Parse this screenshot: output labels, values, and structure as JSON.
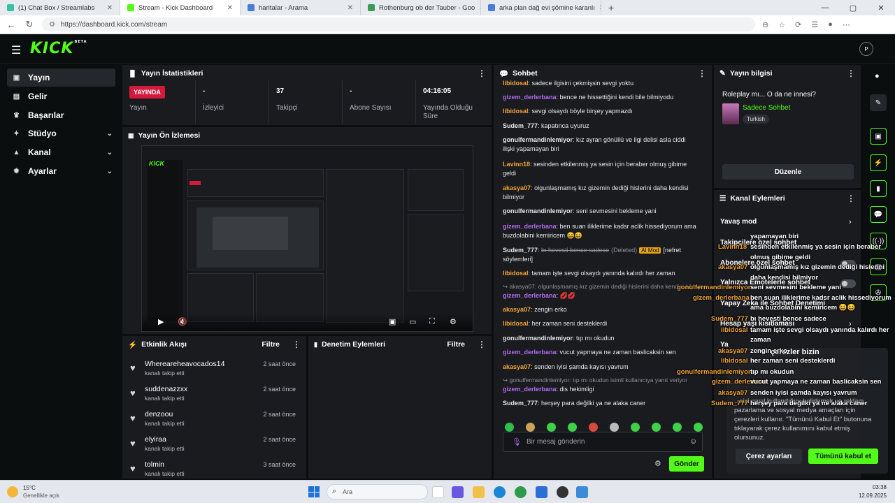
{
  "browser": {
    "tabs": [
      {
        "title": "(1) Chat Box / Streamlabs",
        "color": "#31c3a2",
        "active": false
      },
      {
        "title": "Stream - Kick Dashboard",
        "color": "#53fc18",
        "active": true
      },
      {
        "title": "haritalar - Arama",
        "color": "#4a7bd8",
        "active": false
      },
      {
        "title": "Rothenburg ob der Tauber - Goo",
        "color": "#3a9a56",
        "active": false
      },
      {
        "title": "arka plan dağ evi şömine karanlı",
        "color": "#4a7bd8",
        "active": false
      }
    ],
    "url": "https://dashboard.kick.com/stream"
  },
  "header": {
    "logo": "KICK",
    "logo_badge": "BETA",
    "avatar_initials": "P"
  },
  "sidebar": {
    "items": [
      {
        "label": "Yayın",
        "icon": "broadcast-icon",
        "glyph": "▣",
        "chevron": false,
        "selected": true
      },
      {
        "label": "Gelir",
        "icon": "money-icon",
        "glyph": "▤",
        "chevron": false,
        "selected": false
      },
      {
        "label": "Başarılar",
        "icon": "trophy-icon",
        "glyph": "♛",
        "chevron": false,
        "selected": false
      },
      {
        "label": "Stüdyo",
        "icon": "studio-icon",
        "glyph": "✦",
        "chevron": true,
        "selected": false
      },
      {
        "label": "Kanal",
        "icon": "channel-icon",
        "glyph": "▲",
        "chevron": true,
        "selected": false
      },
      {
        "label": "Ayarlar",
        "icon": "settings-icon",
        "glyph": "✹",
        "chevron": true,
        "selected": false
      }
    ]
  },
  "stats": {
    "title": "Yayın İstatistikleri",
    "live_badge": "YAYINDA",
    "cells": [
      {
        "value": "",
        "label": "Yayın"
      },
      {
        "value": "-",
        "label": "İzleyici"
      },
      {
        "value": "37",
        "label": "Takipçi"
      },
      {
        "value": "-",
        "label": "Abone Sayısı"
      },
      {
        "value": "04:16:05",
        "label": "Yayında Olduğu Süre"
      }
    ]
  },
  "preview": {
    "title": "Yayın Ön İzlemesi"
  },
  "activity": {
    "title": "Etkinlik Akışı",
    "filter": "Filtre",
    "items": [
      {
        "name": "Whereareheavocados14",
        "action": "kanalı takip etti",
        "time": "2 saat önce"
      },
      {
        "name": "suddenazzxx",
        "action": "kanalı takip etti",
        "time": "2 saat önce"
      },
      {
        "name": "denzoou",
        "action": "kanalı takip etti",
        "time": "2 saat önce"
      },
      {
        "name": "elyiraa",
        "action": "kanalı takip etti",
        "time": "2 saat önce"
      },
      {
        "name": "tolmin",
        "action": "kanalı takip etti",
        "time": "3 saat önce"
      }
    ]
  },
  "moderation": {
    "title": "Denetim Eylemleri",
    "filter": "Filtre"
  },
  "chat": {
    "title": "Sohbet",
    "messages": [
      {
        "user": "libidosal",
        "color": "#f2a33a",
        "text": "sadece ilgisini çekmişsin sevgi yoktu"
      },
      {
        "user": "gizem_derlerbana",
        "color": "#b36bf0",
        "text": "bence ne hissettiğini kendi bile bilmiyodu"
      },
      {
        "user": "libidosal",
        "color": "#f2a33a",
        "text": "sevgi olsaydı böyle birşey yapmazdı"
      },
      {
        "user": "Sudem_777",
        "color": "#e6e7e9",
        "text": "kapatınca uyuruz"
      },
      {
        "user": "gonulfermandinlemiyor",
        "color": "#e6e7e9",
        "text": "kız ayran gönüllü ve ilgi delisi asla ciddi ilişki yapamayan biri"
      },
      {
        "user": "Lavinn18",
        "color": "#f2a33a",
        "text": "sesinden etkilenmiş ya sesin için beraber olmuş gibime geldi"
      },
      {
        "user": "akasya07",
        "color": "#f2a33a",
        "text": "olgunlaşmamış kız gizemin dediği hislerini daha kendisi bilmiyor"
      },
      {
        "user": "gonulfermandinlemiyor",
        "color": "#e6e7e9",
        "text": "seni sevmesini bekleme yani"
      },
      {
        "user": "gizem_derlerbana",
        "color": "#b36bf0",
        "text": "ben suan iliklerime kadsr aclik hissediyorum ama buzdolabini kemiricem 😆😆"
      },
      {
        "user": "Sudem_777",
        "color": "#e6e7e9",
        "text": "bı hevesti bence sadece",
        "deleted": "(Deleted)",
        "badge": "AI Mod",
        "reason": "[nefret söylemleri]"
      },
      {
        "user": "libidosal",
        "color": "#f2a33a",
        "text": "tamam işte sevgi olsaydı yanında kalırdı her zaman"
      },
      {
        "reply": "akasya07: olgunlaşmamış kız gizemin dediği hislerini daha kendisi bilmiyor"
      },
      {
        "user": "gizem_derlerbana",
        "color": "#b36bf0",
        "text": "💋💋"
      },
      {
        "user": "akasya07",
        "color": "#f2a33a",
        "text": "zengin erko"
      },
      {
        "user": "libidosal",
        "color": "#f2a33a",
        "text": "her zaman seni desteklerdi"
      },
      {
        "user": "gonulfermandinlemiyor",
        "color": "#e6e7e9",
        "text": "tıp mı okudun"
      },
      {
        "user": "gizem_derlerbana",
        "color": "#b36bf0",
        "text": "vucut yapmaya ne zaman baslicaksin sen"
      },
      {
        "user": "akasya07",
        "color": "#f2a33a",
        "text": "senden iyisi şamda kayısı yavrum"
      },
      {
        "reply": "gonulfermandinlemiyor: tıp mı okudun isimli kullanıcıya yanıt veriyor"
      },
      {
        "user": "gizem_derlerbana",
        "color": "#b36bf0",
        "text": "dis hekimligi"
      },
      {
        "user": "Sudem_777",
        "color": "#e6e7e9",
        "text": "herşey para değilki ya ne alaka caner"
      }
    ],
    "input_placeholder": "Bir mesaj gönderin",
    "send_label": "Gönder"
  },
  "stream_info": {
    "title": "Yayın bilgisi",
    "stream_title": "Roleplay mı... O da ne innesi?",
    "category": "Sadece Sohbet",
    "language": "Turkish",
    "edit_label": "Düzenle"
  },
  "channel_actions": {
    "title": "Kanal Eylemleri",
    "rows": [
      "Yavaş mod",
      "Takipçilere özel sohbet",
      "Abonelere özel sohbet",
      "Yalnızca Emotelerle sohbet",
      "Yapay Zeka ile Sohbet Denetimi",
      "Hesap yaşı kısıtlaması",
      "Ya"
    ]
  },
  "overlay": {
    "lines": [
      {
        "user": "",
        "text": "yapamayan biri"
      },
      {
        "user": "Lavinn18",
        "text": "sesinden etkilenmiş ya sesin için beraber"
      },
      {
        "user": "",
        "text": "olmuş gibime geldi"
      },
      {
        "user": "akasya07",
        "text": "olgunlaşmamış kız gizemin dediği hislerini"
      },
      {
        "user": "",
        "text": "daha kendisi bilmiyor"
      },
      {
        "user": "gonulfermandinlemiyor",
        "text": "seni sevmesini bekleme yani"
      },
      {
        "user": "gizem_derlerbana",
        "text": "ben suan iliklerime kadsr aclik hissediyorum"
      },
      {
        "user": "",
        "text": "ama buzdolabini kemiricem 😆😆"
      },
      {
        "user": "Sudem_777",
        "text": "bı hevesti bence sadece"
      },
      {
        "user": "libidosal",
        "text": "tamam işte sevgi olsaydı yanında kalırdı her"
      },
      {
        "user": "",
        "text": "zaman"
      },
      {
        "user": "akasya07",
        "text": "zengin erko"
      },
      {
        "user": "libidosal",
        "text": "her zaman seni desteklerdi"
      },
      {
        "user": "gonulfermandinlemiyor",
        "text": "tıp mı okudun"
      },
      {
        "user": "gizem_derlerbana",
        "text": "vucut yapmaya ne zaman baslicaksin sen"
      },
      {
        "user": "akasya07",
        "text": "senden iyisi şamda kayısı yavrum"
      },
      {
        "user": "Sudem_777",
        "text": "herşey para değilki ya ne alaka caner"
      }
    ]
  },
  "cookie": {
    "heading": "çerezler bizin",
    "body": "...sizi nasıl kullandığını belirlemek ve reklam, pazarlama ve sosyal medya amaçları için çerezleri kullanır. \"Tümünü Kabul Et\" butonuna tıklayarak çerez kullanımını kabul etmiş olursunuz.",
    "settings_label": "Çerez ayarları",
    "accept_label": "Tümünü kabul et"
  },
  "taskbar": {
    "weather_temp": "15°C",
    "weather_desc": "Genellikle açık",
    "search_placeholder": "Ara",
    "time": "03:38",
    "date": "12.09.2025"
  },
  "colors": {
    "accent": "#53fc18",
    "live": "#d41a3c",
    "panel": "#191b1f",
    "bg": "#0b0e0f"
  }
}
